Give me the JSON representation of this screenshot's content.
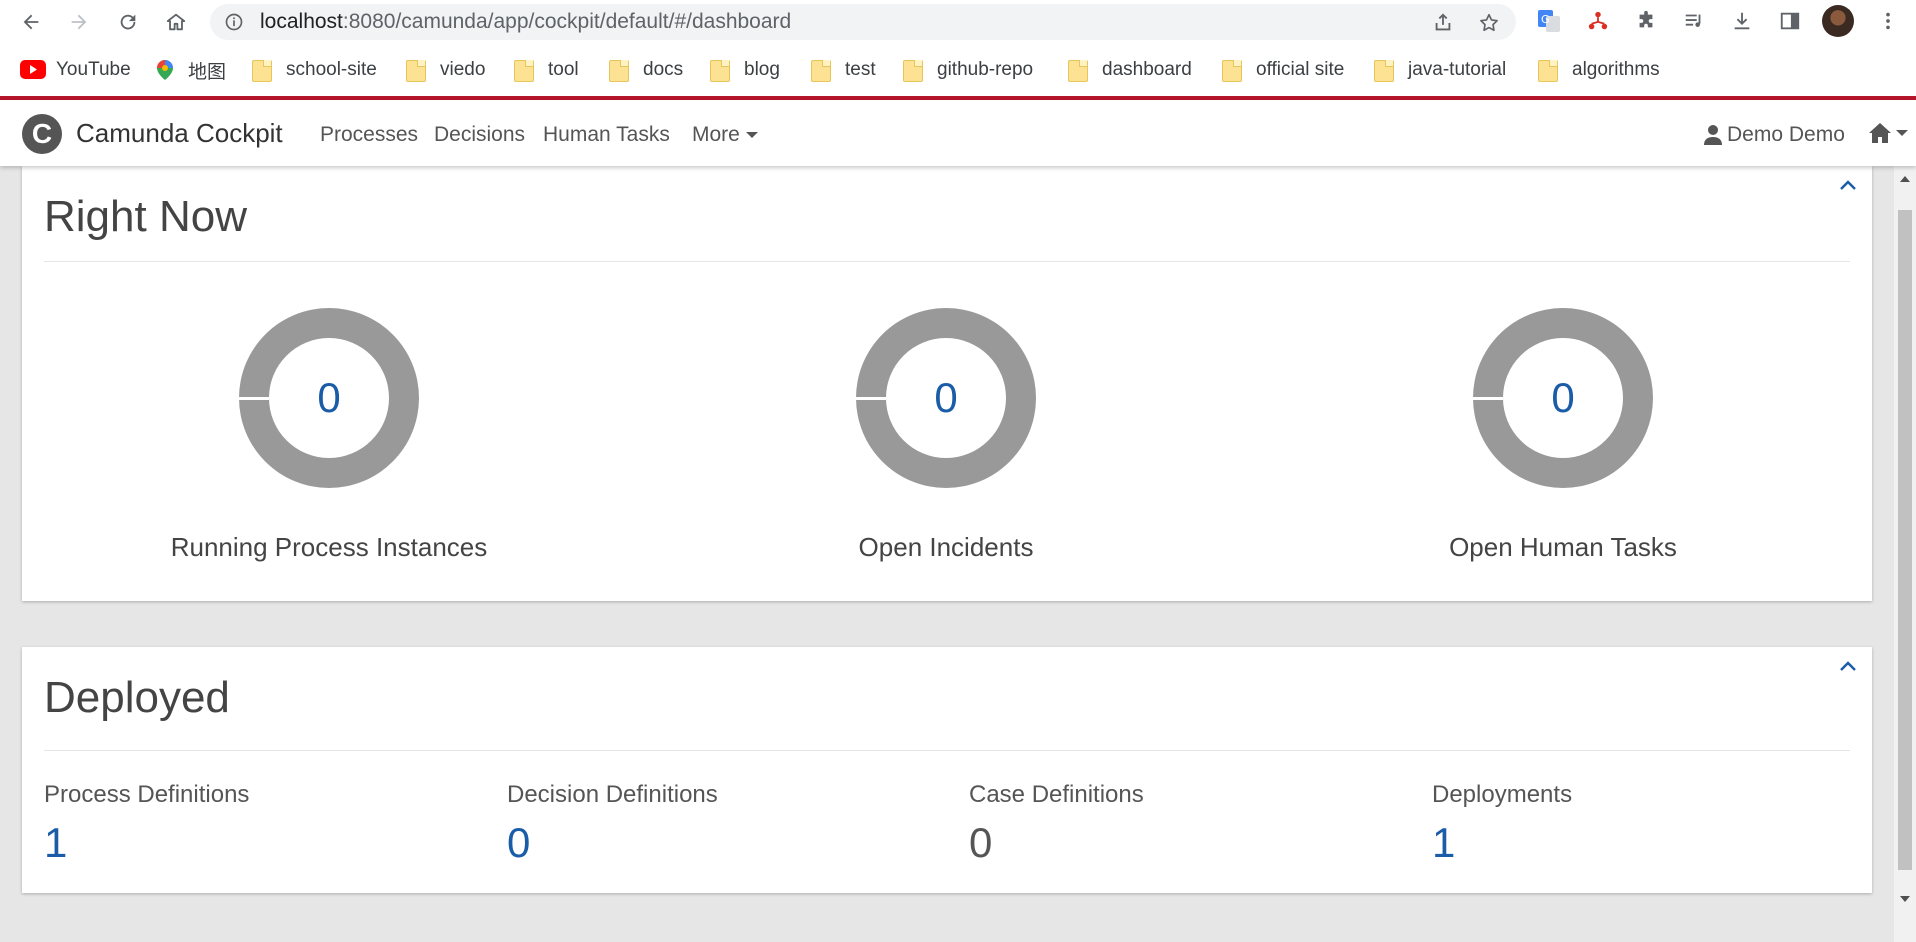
{
  "browser": {
    "url_host": "localhost",
    "url_path": ":8080/camunda/app/cockpit/default/#/dashboard",
    "bookmarks": [
      {
        "label": "YouTube",
        "icon": "youtube-icon"
      },
      {
        "label": "地图",
        "icon": "maps-icon"
      },
      {
        "label": "school-site",
        "icon": "folder-icon"
      },
      {
        "label": "viedo",
        "icon": "folder-icon"
      },
      {
        "label": "tool",
        "icon": "folder-icon"
      },
      {
        "label": "docs",
        "icon": "folder-icon"
      },
      {
        "label": "blog",
        "icon": "folder-icon"
      },
      {
        "label": "test",
        "icon": "folder-icon"
      },
      {
        "label": "github-repo",
        "icon": "folder-icon"
      },
      {
        "label": "dashboard",
        "icon": "folder-icon"
      },
      {
        "label": "official site",
        "icon": "folder-icon"
      },
      {
        "label": "java-tutorial",
        "icon": "folder-icon"
      },
      {
        "label": "algorithms",
        "icon": "folder-icon"
      }
    ]
  },
  "app": {
    "logo_letter": "C",
    "brand": "Camunda Cockpit",
    "nav": [
      "Processes",
      "Decisions",
      "Human Tasks",
      "More"
    ],
    "user": "Demo Demo"
  },
  "right_now": {
    "title": "Right Now",
    "metrics": [
      {
        "value": "0",
        "label": "Running Process Instances"
      },
      {
        "value": "0",
        "label": "Open Incidents"
      },
      {
        "value": "0",
        "label": "Open Human Tasks"
      }
    ]
  },
  "deployed": {
    "title": "Deployed",
    "stats": [
      {
        "label": "Process Definitions",
        "value": "1"
      },
      {
        "label": "Decision Definitions",
        "value": "0"
      },
      {
        "label": "Case Definitions",
        "value": "0"
      },
      {
        "label": "Deployments",
        "value": "1"
      }
    ]
  },
  "colors": {
    "accent_link": "#1a5ca8",
    "donut_gray": "#999999",
    "top_stripe": "#b5152b"
  }
}
